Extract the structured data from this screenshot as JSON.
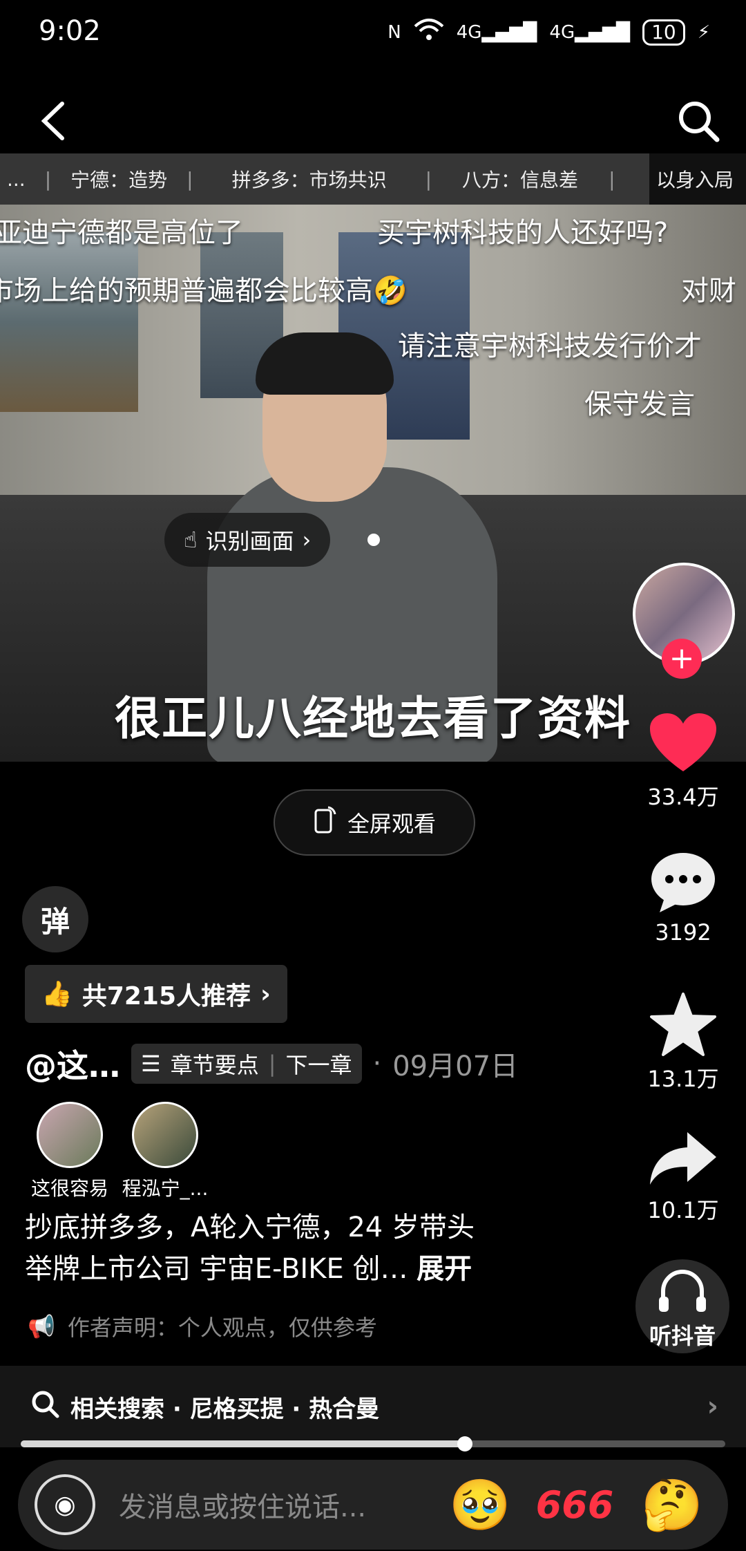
{
  "status": {
    "time": "9:02",
    "battery": "10"
  },
  "chapters": [
    "...",
    "宁德：造势",
    "拼多多：市场共识",
    "八方：信息差",
    "以身入局"
  ],
  "video": {
    "danmaku": [
      "亚迪宁德都是高位了",
      "买宇树科技的人还好吗?",
      "市场上给的预期普遍都会比较高🤣",
      "对财",
      "请注意宇树科技发行价才",
      "保守发言"
    ],
    "subtitle": "很正儿八经地去看了资料",
    "recognize_label": "识别画面"
  },
  "rail": {
    "likes": "33.4万",
    "comments": "3192",
    "favorites": "13.1万",
    "shares": "10.1万",
    "listen_label": "听抖音"
  },
  "fullscreen_label": "全屏观看",
  "danmaku_toggle": "弹",
  "recommend": "共7215人推荐",
  "author": {
    "name": "@这…",
    "chapter_points": "章节要点",
    "next_chapter": "下一章",
    "date": "09月07日"
  },
  "coauthors": [
    "这很容易",
    "程泓宁_..."
  ],
  "description": {
    "line1": "抄底拼多多，A轮入宁德，24 岁带头",
    "line2": "举牌上市公司 宇宙E-BIKE 创…",
    "expand": "展开"
  },
  "notice": "作者声明：个人观点，仅供参考",
  "related": {
    "label": "相关搜索 · 尼格买提 · 热合曼"
  },
  "progress": 0.63,
  "message": {
    "placeholder": "发消息或按住说话...",
    "emoji1": "🥹",
    "emoji_666": "666",
    "emoji3": "🤔"
  },
  "colors": {
    "accent": "#fe2c55",
    "background": "#000000"
  }
}
